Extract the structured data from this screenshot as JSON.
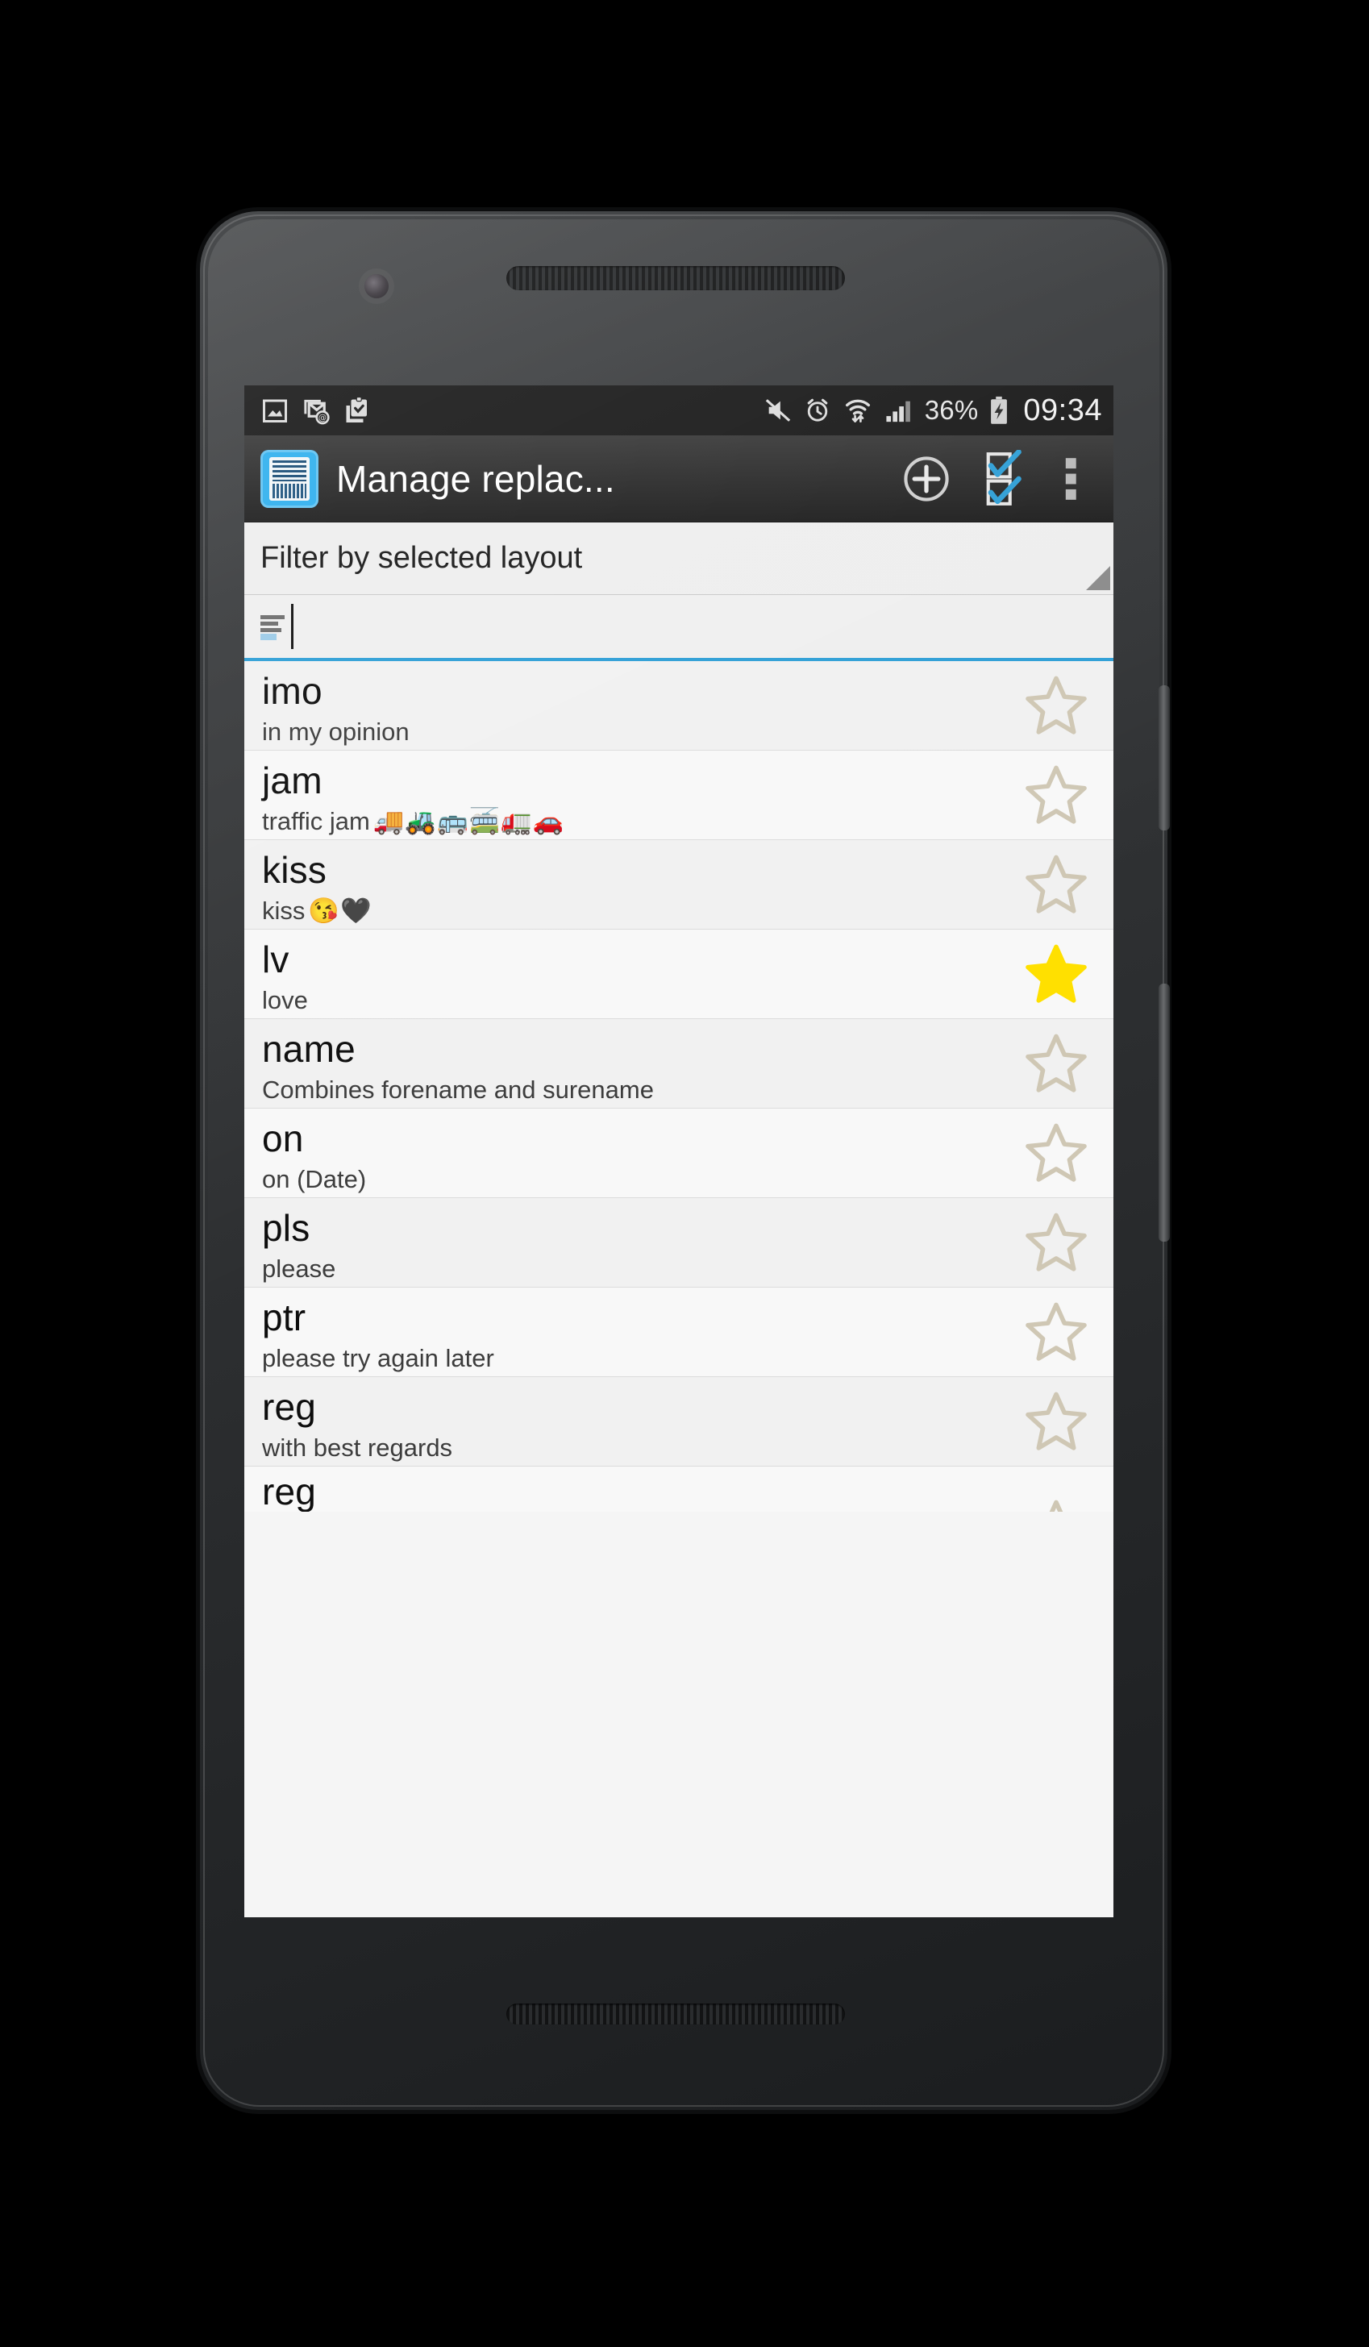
{
  "status_bar": {
    "icons_left": [
      "image-icon",
      "mail-at-icon",
      "clipboard-check-icon"
    ],
    "icons_right": [
      "mute-icon",
      "alarm-icon",
      "wifi-transfer-icon",
      "signal-bars-icon"
    ],
    "battery_percent": "36%",
    "battery_state": "charging",
    "time": "09:34"
  },
  "action_bar": {
    "app_icon": "keyboard-app-icon",
    "title": "Manage replac...",
    "actions": [
      {
        "name": "add-button",
        "icon": "plus-circle-icon"
      },
      {
        "name": "select-all-button",
        "icon": "checkbox-multi-select-icon"
      },
      {
        "name": "overflow-button",
        "icon": "more-vertical-icon"
      }
    ]
  },
  "filter": {
    "spinner_label": "Filter by selected layout",
    "spinner_icon": "dropdown-triangle-icon",
    "input_value": "",
    "input_icon": "layout-lines-icon"
  },
  "colors": {
    "accent": "#2f9fd6",
    "app_icon": "#31b0ee",
    "star_filled": "#ffe000",
    "star_outline": "#cfc7b4",
    "statusbar_bg": "#1b1b1b",
    "actionbar_bg": "#2b2b2b"
  },
  "list": {
    "rows": [
      {
        "key": "imo",
        "value": "in my opinion",
        "emoji": "",
        "favorite": false
      },
      {
        "key": "jam",
        "value": "traffic jam",
        "emoji": "🚚🚜🚌🚎🚛🚗",
        "favorite": false
      },
      {
        "key": "kiss",
        "value": "kiss",
        "emoji": "😘🖤",
        "favorite": false
      },
      {
        "key": "lv",
        "value": "love",
        "emoji": "",
        "favorite": true
      },
      {
        "key": "name",
        "value": "Combines forename and surename",
        "emoji": "",
        "favorite": false
      },
      {
        "key": "on",
        "value": "on (Date)",
        "emoji": "",
        "favorite": false
      },
      {
        "key": "pls",
        "value": "please",
        "emoji": "",
        "favorite": false
      },
      {
        "key": "ptr",
        "value": "please try again later",
        "emoji": "",
        "favorite": false
      },
      {
        "key": "reg",
        "value": "with best regards",
        "emoji": "",
        "favorite": false
      },
      {
        "key": "reg",
        "value": "",
        "emoji": "",
        "favorite": false
      }
    ]
  }
}
